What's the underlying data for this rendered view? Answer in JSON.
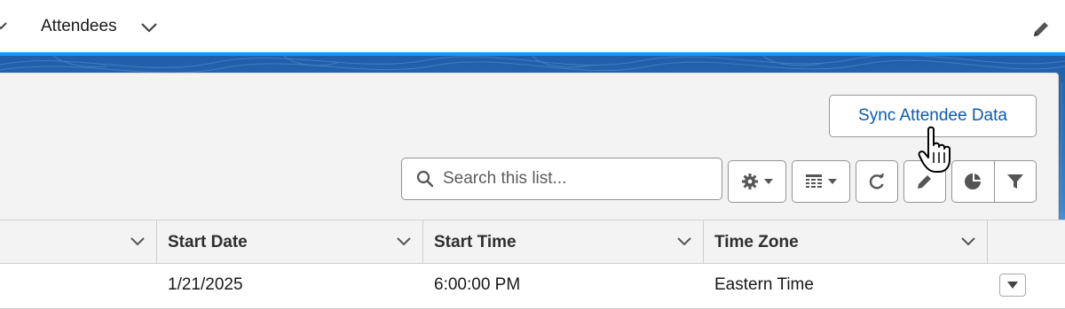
{
  "nav": {
    "tab_label": "Attendees"
  },
  "actions": {
    "sync_label": "Sync Attendee Data"
  },
  "search": {
    "placeholder": "Search this list...",
    "value": ""
  },
  "toolbar": {
    "settings_icon": "gear-icon",
    "display_icon": "table-icon",
    "refresh_icon": "refresh-icon",
    "edit_icon": "pencil-icon",
    "chart_icon": "pie-chart-icon",
    "filter_icon": "filter-icon"
  },
  "table": {
    "columns": [
      "",
      "Start Date",
      "Start Time",
      "Time Zone",
      ""
    ],
    "rows": [
      {
        "start_date": "1/21/2025",
        "start_time": "6:00:00 PM",
        "time_zone": "Eastern Time"
      }
    ]
  },
  "colors": {
    "accent": "#1b96ff",
    "link": "#0b5cab",
    "banner": "#1f5fa8"
  }
}
